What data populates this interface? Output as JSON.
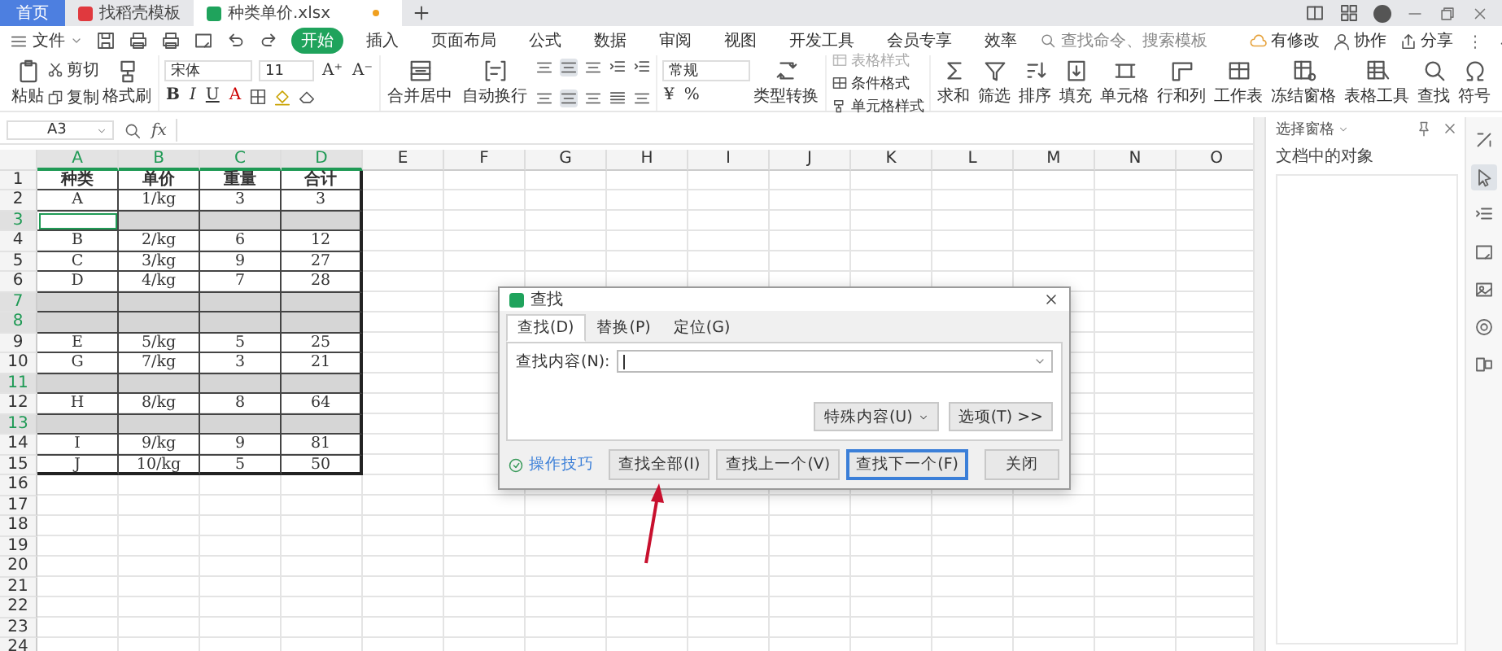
{
  "browser_tabs": [
    {
      "label": "首页",
      "kind": "home",
      "selected": false
    },
    {
      "label": "找稻壳模板",
      "kind": "docer",
      "selected": false
    },
    {
      "label": "种类单价.xlsx",
      "kind": "sheet",
      "selected": true
    }
  ],
  "menu": {
    "file": "文件",
    "tabs": [
      {
        "label": "开始",
        "selected": true
      },
      {
        "label": "插入",
        "selected": false
      },
      {
        "label": "页面布局",
        "selected": false
      },
      {
        "label": "公式",
        "selected": false
      },
      {
        "label": "数据",
        "selected": false
      },
      {
        "label": "审阅",
        "selected": false
      },
      {
        "label": "视图",
        "selected": false
      },
      {
        "label": "开发工具",
        "selected": false
      },
      {
        "label": "会员专享",
        "selected": false
      },
      {
        "label": "效率",
        "selected": false
      }
    ],
    "search": {
      "placeholder": "查找命令、搜索模板"
    },
    "actions": [
      {
        "label": "有修改",
        "kind": "cloud"
      },
      {
        "label": "协作",
        "kind": "person"
      },
      {
        "label": "分享",
        "kind": "share"
      }
    ]
  },
  "ribbon": {
    "paste": "粘贴",
    "clipboard": [
      {
        "label": "剪切",
        "kind": "cut"
      },
      {
        "label": "复制",
        "kind": "copy"
      }
    ],
    "painter": "格式刷",
    "font": {
      "name": "宋体",
      "size": "11"
    },
    "size_buttons": [
      "A⁺",
      "A⁻"
    ],
    "font_buttons": [
      "B",
      "I",
      "U",
      "A"
    ],
    "merge": "合并居中",
    "wrap": "自动换行",
    "number_format": "常规",
    "number_buttons": [
      "¥",
      "%"
    ],
    "convert": "类型转换",
    "styles": [
      {
        "label": "表格样式",
        "kind": "table",
        "disabled": true
      },
      {
        "label": "条件格式",
        "kind": "cond",
        "disabled": false
      },
      {
        "label": "单元格样式",
        "kind": "brush",
        "disabled": false
      }
    ],
    "tools": [
      {
        "label": "求和",
        "kind": "sum"
      },
      {
        "label": "筛选",
        "kind": "filter"
      },
      {
        "label": "排序",
        "kind": "sort"
      },
      {
        "label": "填充",
        "kind": "fill"
      },
      {
        "label": "单元格",
        "kind": "cell"
      },
      {
        "label": "行和列",
        "kind": "rows"
      },
      {
        "label": "工作表",
        "kind": "sheet"
      },
      {
        "label": "冻结窗格",
        "kind": "freeze"
      },
      {
        "label": "表格工具",
        "kind": "grid"
      },
      {
        "label": "查找",
        "kind": "find"
      },
      {
        "label": "符号",
        "kind": "omega"
      }
    ]
  },
  "formula_bar": {
    "name_box": "A3",
    "fx": "fx"
  },
  "sheet": {
    "columns": [
      {
        "label": "A",
        "selected": true
      },
      {
        "label": "B",
        "selected": true
      },
      {
        "label": "C",
        "selected": true
      },
      {
        "label": "D",
        "selected": true
      },
      {
        "label": "E",
        "selected": false
      },
      {
        "label": "F",
        "selected": false
      },
      {
        "label": "G",
        "selected": false
      },
      {
        "label": "H",
        "selected": false
      },
      {
        "label": "I",
        "selected": false
      },
      {
        "label": "J",
        "selected": false
      },
      {
        "label": "K",
        "selected": false
      },
      {
        "label": "L",
        "selected": false
      },
      {
        "label": "M",
        "selected": false
      },
      {
        "label": "N",
        "selected": false
      },
      {
        "label": "O",
        "selected": false
      }
    ],
    "rows": [
      {
        "number": "1",
        "selected": false,
        "active": false,
        "cells": [
          "种类",
          "单价",
          "重量",
          "合计"
        ]
      },
      {
        "number": "2",
        "selected": false,
        "active": false,
        "cells": [
          "A",
          "1/kg",
          "3",
          "3"
        ]
      },
      {
        "number": "3",
        "selected": true,
        "active": true
      },
      {
        "number": "4",
        "selected": false,
        "active": false,
        "cells": [
          "B",
          "2/kg",
          "6",
          "12"
        ]
      },
      {
        "number": "5",
        "selected": false,
        "active": false,
        "cells": [
          "C",
          "3/kg",
          "9",
          "27"
        ]
      },
      {
        "number": "6",
        "selected": false,
        "active": false,
        "cells": [
          "D",
          "4/kg",
          "7",
          "28"
        ]
      },
      {
        "number": "7",
        "selected": true,
        "active": false
      },
      {
        "number": "8",
        "selected": true,
        "active": false
      },
      {
        "number": "9",
        "selected": false,
        "active": false,
        "cells": [
          "E",
          "5/kg",
          "5",
          "25"
        ]
      },
      {
        "number": "10",
        "selected": false,
        "active": false,
        "cells": [
          "G",
          "7/kg",
          "3",
          "21"
        ]
      },
      {
        "number": "11",
        "selected": true,
        "active": false
      },
      {
        "number": "12",
        "selected": false,
        "active": false,
        "cells": [
          "H",
          "8/kg",
          "8",
          "64"
        ]
      },
      {
        "number": "13",
        "selected": true,
        "active": false
      },
      {
        "number": "14",
        "selected": false,
        "active": false,
        "cells": [
          "I",
          "9/kg",
          "9",
          "81"
        ]
      },
      {
        "number": "15",
        "selected": false,
        "active": false,
        "cells": [
          "J",
          "10/kg",
          "5",
          "50"
        ]
      },
      {
        "number": "16",
        "selected": false,
        "active": false
      },
      {
        "number": "17",
        "selected": false,
        "active": false
      },
      {
        "number": "18",
        "selected": false,
        "active": false
      },
      {
        "number": "19",
        "selected": false,
        "active": false
      },
      {
        "number": "20",
        "selected": false,
        "active": false
      },
      {
        "number": "21",
        "selected": false,
        "active": false
      },
      {
        "number": "22",
        "selected": false,
        "active": false
      },
      {
        "number": "23",
        "selected": false,
        "active": false
      },
      {
        "number": "24",
        "selected": false,
        "active": false
      }
    ]
  },
  "selection_pane": {
    "title": "选择窗格",
    "subtitle": "文档中的对象"
  },
  "dialog": {
    "title": "查找",
    "tabs": [
      {
        "label": "查找(D)",
        "selected": true
      },
      {
        "label": "替换(P)",
        "selected": false
      },
      {
        "label": "定位(G)",
        "selected": false
      }
    ],
    "find_label": "查找内容(N):",
    "option_buttons": [
      "特殊内容(U)",
      "选项(T) >>"
    ],
    "tips": "操作技巧",
    "buttons": [
      {
        "label": "查找全部(I)",
        "focused": false
      },
      {
        "label": "查找上一个(V)",
        "focused": false
      },
      {
        "label": "查找下一个(F)",
        "focused": true
      },
      {
        "label": "关闭",
        "focused": false
      }
    ]
  }
}
